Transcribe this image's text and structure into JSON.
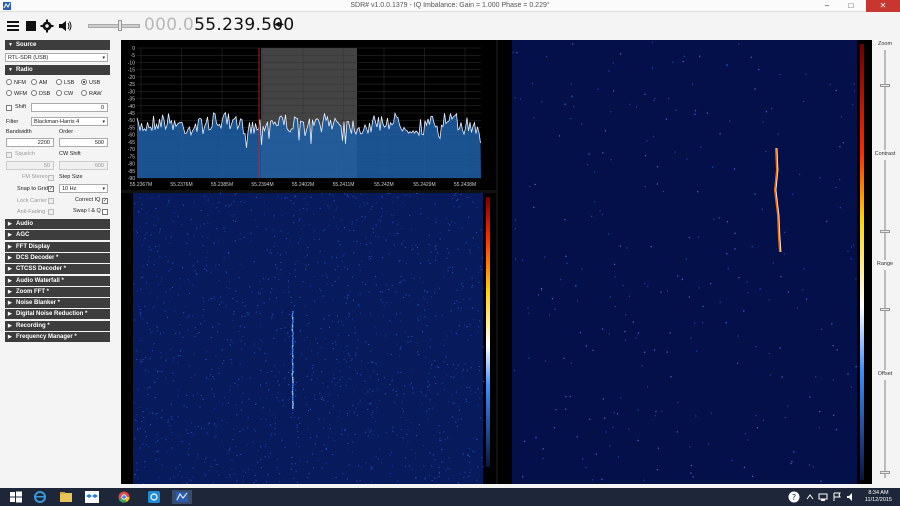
{
  "window": {
    "title": "SDR# v1.0.0.1379 - IQ Imbalance: Gain = 1.000 Phase = 0.229°",
    "minimize_icon": "minimize-icon",
    "maximize_icon": "maximize-icon",
    "close_icon": "close-icon"
  },
  "toolbar": {
    "menu_icon": "hamburger-icon",
    "stop_icon": "stop-icon",
    "settings_icon": "gear-icon",
    "audio_icon": "speaker-icon",
    "frequency_dim": "000.0",
    "frequency_lit": "55.239.500",
    "tuning_arrows": "◂▸"
  },
  "panel": {
    "source": {
      "header": "Source",
      "device": "RTL-SDR (USB)"
    },
    "radio": {
      "header": "Radio",
      "modes_row1": [
        "NFM",
        "AM",
        "LSB",
        "USB"
      ],
      "modes_row2": [
        "WFM",
        "DSB",
        "CW",
        "RAW"
      ],
      "selected_mode": "USB",
      "shift_label": "Shift",
      "shift_value": "0",
      "filter_label": "Filter",
      "filter_value": "Blackman-Harris 4",
      "bandwidth_label": "Bandwidth",
      "bandwidth_value": "2200",
      "order_label": "Order",
      "order_value": "500",
      "squelch_label": "Squelch",
      "squelch_value": "50",
      "cw_shift_label": "CW Shift",
      "cw_shift_value": "600",
      "fm_stereo_label": "FM Stereo",
      "step_size_label": "Step Size",
      "snap_to_grid_label": "Snap to Grid",
      "step_size_value": "10 Hz",
      "lock_carrier_label": "Lock Carrier",
      "correct_iq_label": "Correct IQ",
      "anti_fading_label": "Anti-Fading",
      "swap_iq_label": "Swap I & Q"
    },
    "collapsed_sections": [
      "Audio",
      "AGC",
      "FFT Display",
      "DCS Decoder *",
      "CTCSS Decoder *",
      "Audio Waterfall *",
      "Zoom FFT *",
      "Noise Blanker *",
      "Digital Noise Reduction *",
      "Recording *",
      "Frequency Manager *"
    ]
  },
  "spectrum": {
    "y_ticks": [
      "0",
      "-5",
      "-10",
      "-15",
      "-20",
      "-25",
      "-30",
      "-35",
      "-40",
      "-45",
      "-50",
      "-55",
      "-60",
      "-65",
      "-70",
      "-75",
      "-80",
      "-85",
      "-90"
    ],
    "x_ticks": [
      "55.2367M",
      "55.2376M",
      "55.2385M",
      "55.2394M",
      "55.2402M",
      "55.2411M",
      "55.242M",
      "55.2429M",
      "55.2438M"
    ]
  },
  "right_panel": {
    "zoom_label": "Zoom",
    "contrast_label": "Contrast",
    "range_label": "Range",
    "offset_label": "Offset"
  },
  "taskbar": {
    "start_icon": "windows-start-icon",
    "apps": [
      "ie-icon",
      "explorer-icon",
      "dropbox-icon",
      "chrome-icon",
      "skype-icon",
      "sdrsharp-icon"
    ],
    "time": "8:34 AM",
    "date": "11/12/2015"
  },
  "colors": {
    "section_header": "#3d3d3d",
    "spectrum_fill": "#1f5fa8",
    "waterfall_bg": "#061a5c",
    "close_button": "#c7362f",
    "taskbar": "#1d2739"
  }
}
